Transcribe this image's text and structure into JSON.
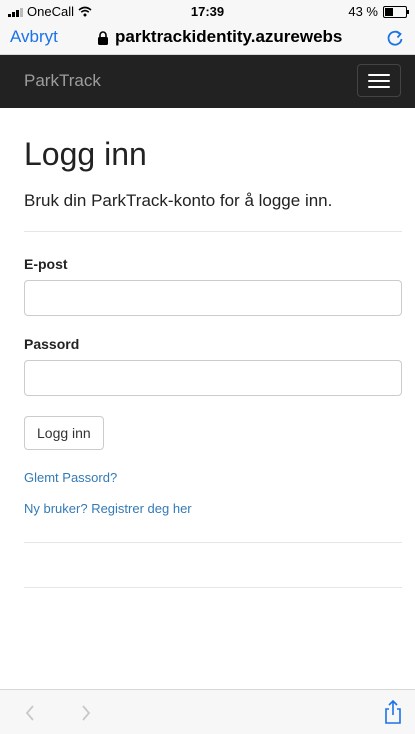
{
  "status_bar": {
    "carrier": "OneCall",
    "time": "17:39",
    "battery": "43 %",
    "battery_level": 0.43
  },
  "browser": {
    "cancel_label": "Avbryt",
    "url": "parktrackidentity.azurewebs"
  },
  "navbar": {
    "brand": "ParkTrack"
  },
  "login": {
    "title": "Logg inn",
    "subtitle": "Bruk din ParkTrack-konto for å logge inn.",
    "email_label": "E-post",
    "email_value": "",
    "password_label": "Passord",
    "password_value": "",
    "submit_label": "Logg inn",
    "forgot_link": "Glemt Passord?",
    "register_link": "Ny bruker? Registrer deg her"
  },
  "icons": {
    "signal": "signal-bars-icon",
    "wifi": "wifi-icon",
    "battery": "battery-icon",
    "lock": "lock-icon",
    "reload": "reload-icon",
    "menu": "hamburger-icon",
    "back": "chevron-left-icon",
    "forward": "chevron-right-icon",
    "share": "share-icon"
  },
  "colors": {
    "link": "#337ab7",
    "navbar": "#222222",
    "browser_accent": "#1a73e8"
  }
}
